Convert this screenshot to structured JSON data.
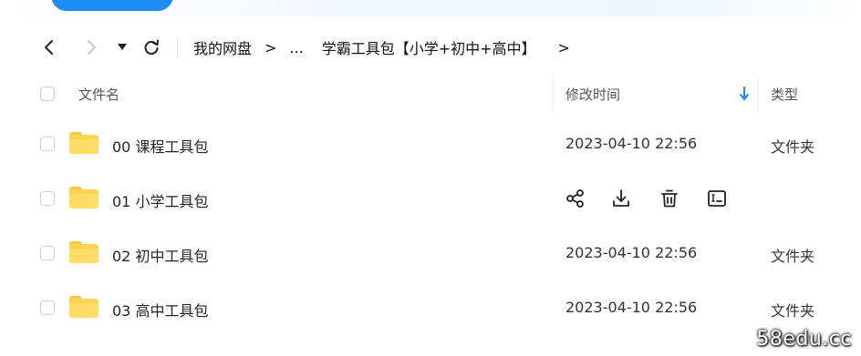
{
  "toolbar": {
    "breadcrumb": {
      "root": "我的网盘",
      "ellipsis": "...",
      "current": "学霸工具包【小学+初中+高中】",
      "separator": ">"
    }
  },
  "table": {
    "headers": {
      "name": "文件名",
      "modified": "修改时间",
      "type": "类型"
    },
    "sort_icon": "arrow-down-icon",
    "rows": [
      {
        "name": "00 课程工具包",
        "modified": "2023-04-10 22:56",
        "type": "文件夹",
        "hovered": false
      },
      {
        "name": "01 小学工具包",
        "modified": "",
        "type": "",
        "hovered": true
      },
      {
        "name": "02 初中工具包",
        "modified": "2023-04-10 22:56",
        "type": "文件夹",
        "hovered": false
      },
      {
        "name": "03 高中工具包",
        "modified": "2023-04-10 22:56",
        "type": "文件夹",
        "hovered": false
      }
    ],
    "row_actions": [
      "share-icon",
      "download-icon",
      "delete-icon",
      "rename-icon"
    ]
  },
  "watermark": "58edu.cc",
  "colors": {
    "accent": "#1c8cf2",
    "folder": "#ffd454",
    "sort_arrow": "#1c8cf2"
  }
}
